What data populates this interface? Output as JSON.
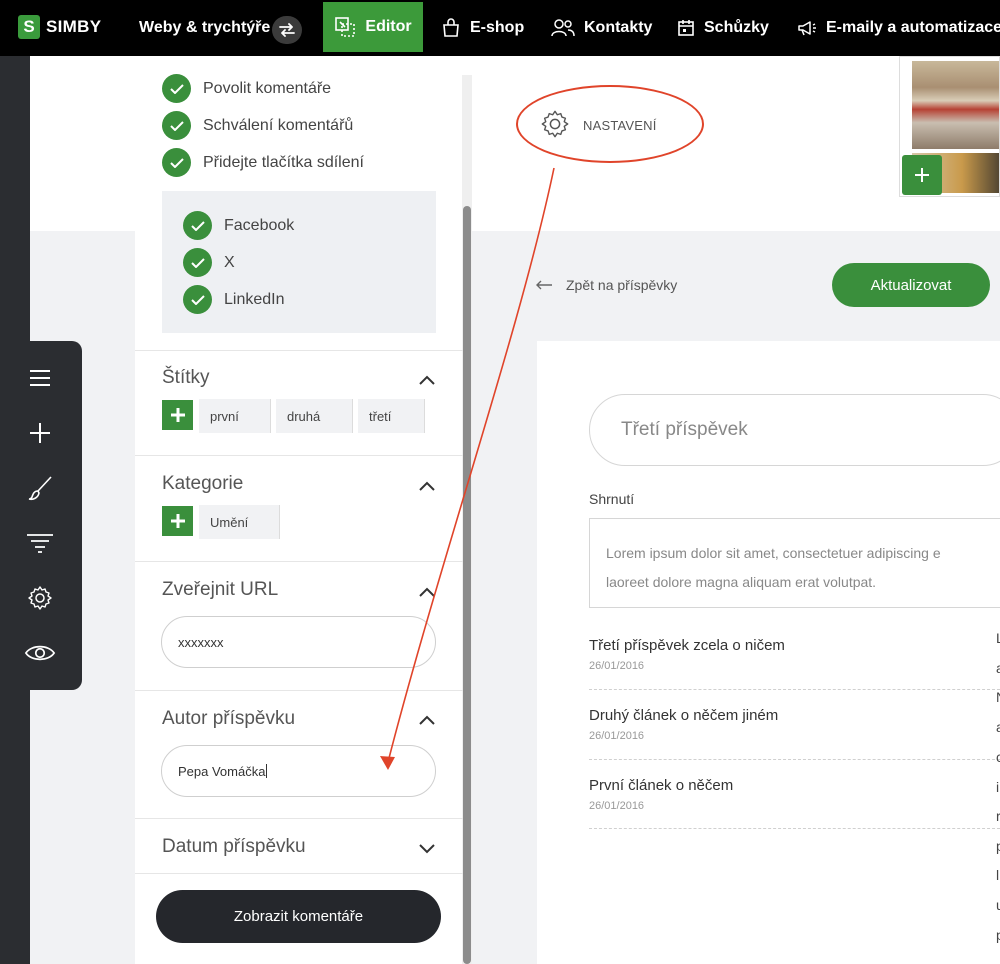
{
  "topbar": {
    "logo_text": "SIMBY",
    "logo_mark": "S",
    "nav": {
      "sites": "Weby & trychtýře",
      "editor": "Editor",
      "eshop": "E-shop",
      "contacts": "Kontakty",
      "meetings": "Schůzky",
      "emails": "E-maily a automatizace"
    }
  },
  "colors": {
    "accent": "#3a8f3c",
    "annotation": "#e0442a",
    "dark": "#25272c"
  },
  "sidebar": {
    "options": [
      "Povolit komentáře",
      "Schválení komentářů",
      "Přidejte tlačítka sdílení"
    ],
    "share_options": [
      "Facebook",
      "X",
      "LinkedIn"
    ],
    "tags_title": "Štítky",
    "tags": [
      "první",
      "druhá",
      "třetí"
    ],
    "category_title": "Kategorie",
    "categories": [
      "Umění"
    ],
    "url_title": "Zveřejnit URL",
    "url_value": "xxxxxxx",
    "author_title": "Autor příspěvku",
    "author_value": "Pepa Vomáčka",
    "date_title": "Datum příspěvku",
    "comments_button": "Zobrazit komentáře"
  },
  "main": {
    "settings_label": "NASTAVENÍ",
    "back_label": "Zpět na příspěvky",
    "update_button": "Aktualizovat",
    "title_value": "Třetí příspěvek",
    "summary_label": "Shrnutí",
    "summary_line1": "Lorem ipsum dolor sit amet, consectetuer adipiscing e",
    "summary_line2": "laoreet dolore magna aliquam erat volutpat.",
    "posts": [
      {
        "title": "Třetí příspěvek zcela o ničem",
        "date": "26/01/2016"
      },
      {
        "title": "Druhý článek o něčem jiném",
        "date": "26/01/2016"
      },
      {
        "title": "První článek o něčem",
        "date": "26/01/2016"
      }
    ],
    "right_column_letters": [
      "L",
      "a",
      "N",
      "a",
      "c",
      "i",
      "r",
      "p",
      "l",
      "u",
      "p"
    ]
  }
}
